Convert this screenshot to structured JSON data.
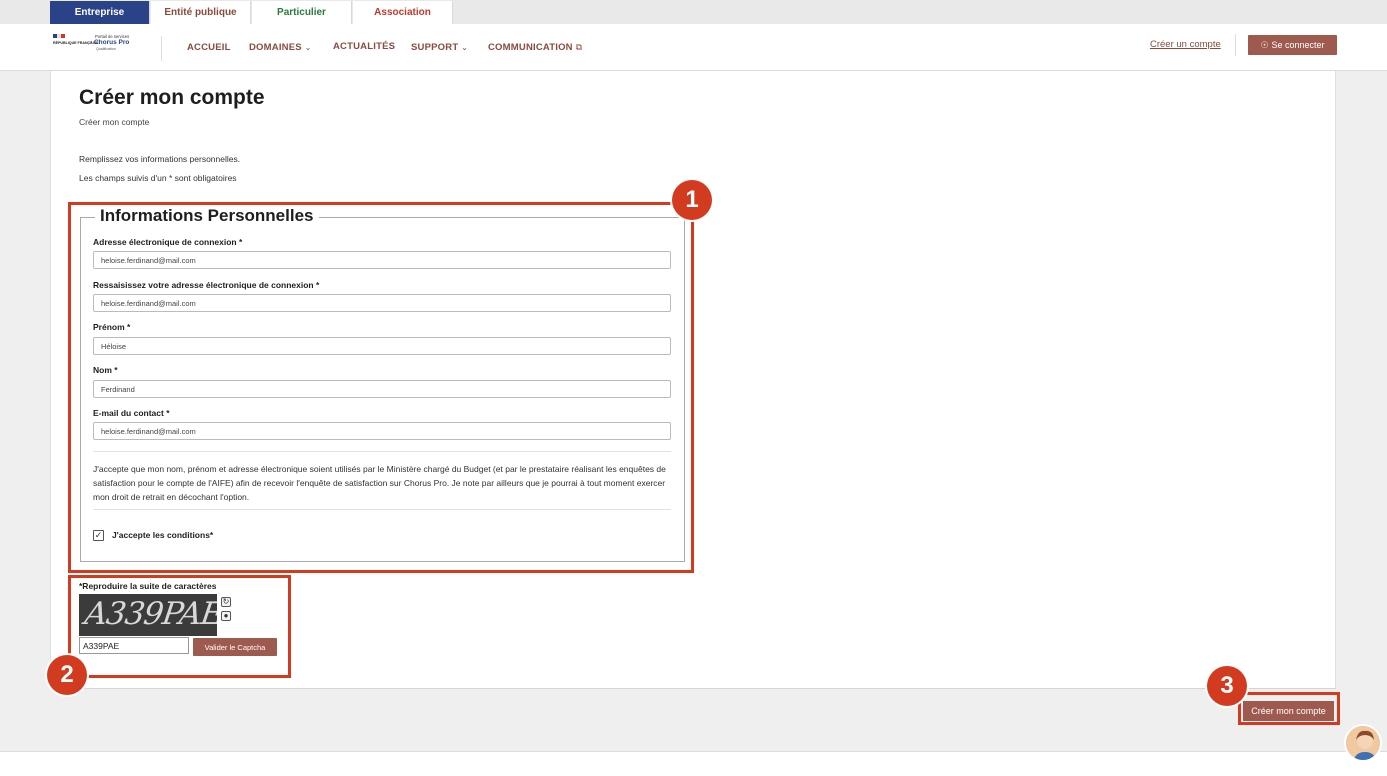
{
  "audience_tabs": [
    "Entreprise",
    "Entité publique",
    "Particulier",
    "Association"
  ],
  "audience_colors": {
    "active_bg": "#2a4388",
    "entite": "#8b4a3c",
    "particulier": "#2a7a3a",
    "association": "#c0392b"
  },
  "logo": {
    "republic": "RÉPUBLIQUE FRANÇAISE",
    "portal": "Portail de services",
    "brand": "Chorus Pro",
    "env": "Qualification"
  },
  "nav": {
    "accueil": "ACCUEIL",
    "domaines": "DOMAINES",
    "actualites": "ACTUALITÉS",
    "support": "SUPPORT",
    "communication": "COMMUNICATION"
  },
  "header_actions": {
    "create_account": "Créer un compte",
    "login": "Se connecter"
  },
  "page": {
    "title": "Créer mon compte",
    "breadcrumb": "Créer mon compte",
    "intro1": "Remplissez vos informations personnelles.",
    "intro2": "Les champs suivis d'un * sont obligatoires"
  },
  "form": {
    "legend": "Informations Personnelles",
    "fields": [
      {
        "label": "Adresse électronique de connexion",
        "value": "heloise.ferdinand@mail.com"
      },
      {
        "label": "Ressaisissez votre adresse électronique de connexion",
        "value": "heloise.ferdinand@mail.com"
      },
      {
        "label": "Prénom",
        "value": "Héloise"
      },
      {
        "label": "Nom",
        "value": "Ferdinand"
      },
      {
        "label": "E-mail du contact",
        "value": "heloise.ferdinand@mail.com"
      }
    ],
    "required_mark": "*",
    "consent_text": "J'accepte que mon nom, prénom et adresse électronique soient utilisés par le Ministère chargé du Budget (et par le prestataire réalisant les enquêtes de satisfaction pour le compte de l'AIFE) afin de recevoir l'enquête de satisfaction sur Chorus Pro. Je note par ailleurs que je pourrai à tout moment exercer mon droit de retrait en décochant l'option.",
    "checkbox_checked": true,
    "checkbox_label": "J'accepte les conditions*"
  },
  "captcha": {
    "label": "*Reproduire la suite de caractères",
    "image_text": "A339PAE",
    "input_value": "A339PAE",
    "validate_label": "Valider le Captcha",
    "refresh_icon": "refresh-icon",
    "audio_icon": "audio-icon"
  },
  "annotations": {
    "one": "1",
    "two": "2",
    "three": "3",
    "color": "#d33b20"
  },
  "submit_label": "Créer mon compte"
}
